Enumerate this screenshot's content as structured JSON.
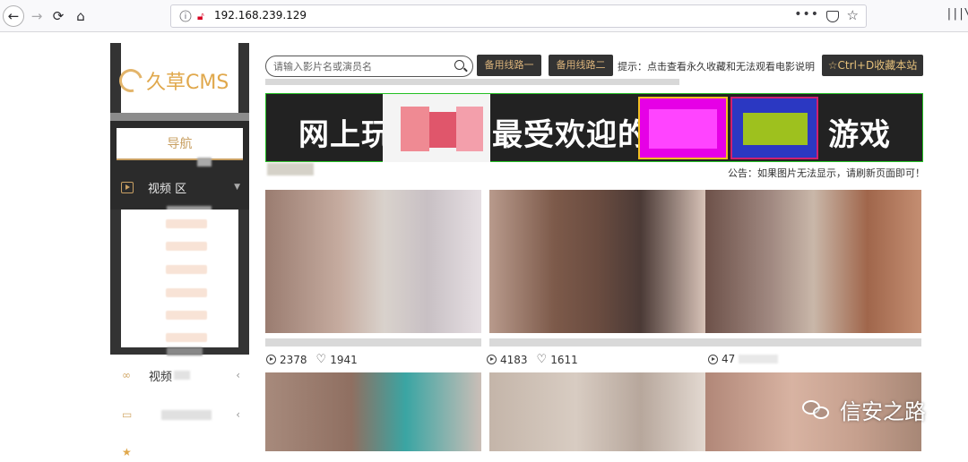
{
  "browser": {
    "url": "192.168.239.129",
    "url_actions": "•••"
  },
  "sidebar": {
    "logo": "久草CMS",
    "nav_title": "导航",
    "video_menu": "视频 区",
    "item2": "视频",
    "item3": ""
  },
  "topbar": {
    "search_placeholder": "请输入影片名或演员名",
    "route1": "备用线路一",
    "route2": "备用线路二",
    "tip": "提示：点击查看永久收藏和无法观看电影说明",
    "favorite": "☆Ctrl+D收藏本站"
  },
  "banner": {
    "t1": "网上玩",
    "t2": "最受欢迎的",
    "t3": "游戏"
  },
  "notice": "公告：如果图片无法显示，请刷新页面即可！",
  "videos": [
    {
      "views": "2378",
      "likes": "1941"
    },
    {
      "views": "4183",
      "likes": "1611"
    },
    {
      "views": "47",
      "likes": ""
    }
  ],
  "watermark": "信安之路",
  "colors": {
    "accent_gold": "#c9a063",
    "dark": "#333333",
    "banner_border": "#24c024"
  }
}
